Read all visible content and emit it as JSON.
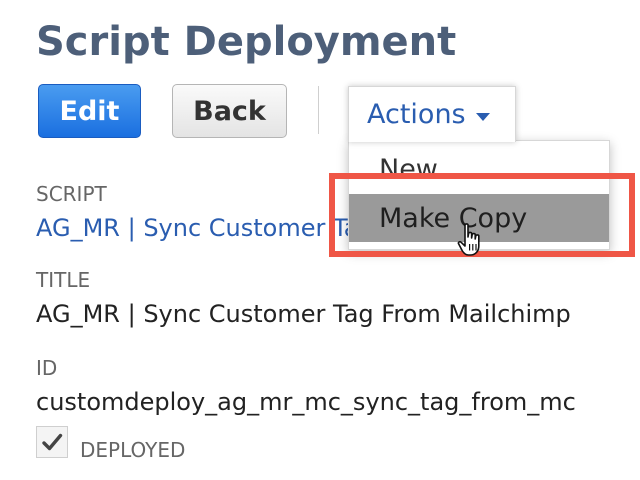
{
  "header": {
    "title": "Script Deployment"
  },
  "toolbar": {
    "edit_label": "Edit",
    "back_label": "Back",
    "actions_label": "Actions",
    "actions_menu": {
      "items": [
        {
          "label": "New"
        },
        {
          "label": "Make Copy"
        }
      ],
      "hovered_item": "Make Copy"
    }
  },
  "fields": {
    "script": {
      "label": "SCRIPT",
      "value": "AG_MR | Sync Customer Tag From Mailchimp"
    },
    "title": {
      "label": "TITLE",
      "value": "AG_MR | Sync Customer Tag From Mailchimp"
    },
    "id": {
      "label": "ID",
      "value": "customdeploy_ag_mr_mc_sync_tag_from_mc"
    },
    "deployed": {
      "label": "DEPLOYED",
      "checked": true
    }
  },
  "colors": {
    "title": "#4d5f79",
    "link": "#2a5db0",
    "primary_button": "#1a6fe0",
    "highlight": "#ef5646",
    "menu_hover": "#9a9a9a"
  },
  "icons": {
    "actions_caret": "caret-down-icon",
    "cursor": "hand-pointer-icon",
    "deployed_check": "check-mark-icon"
  }
}
